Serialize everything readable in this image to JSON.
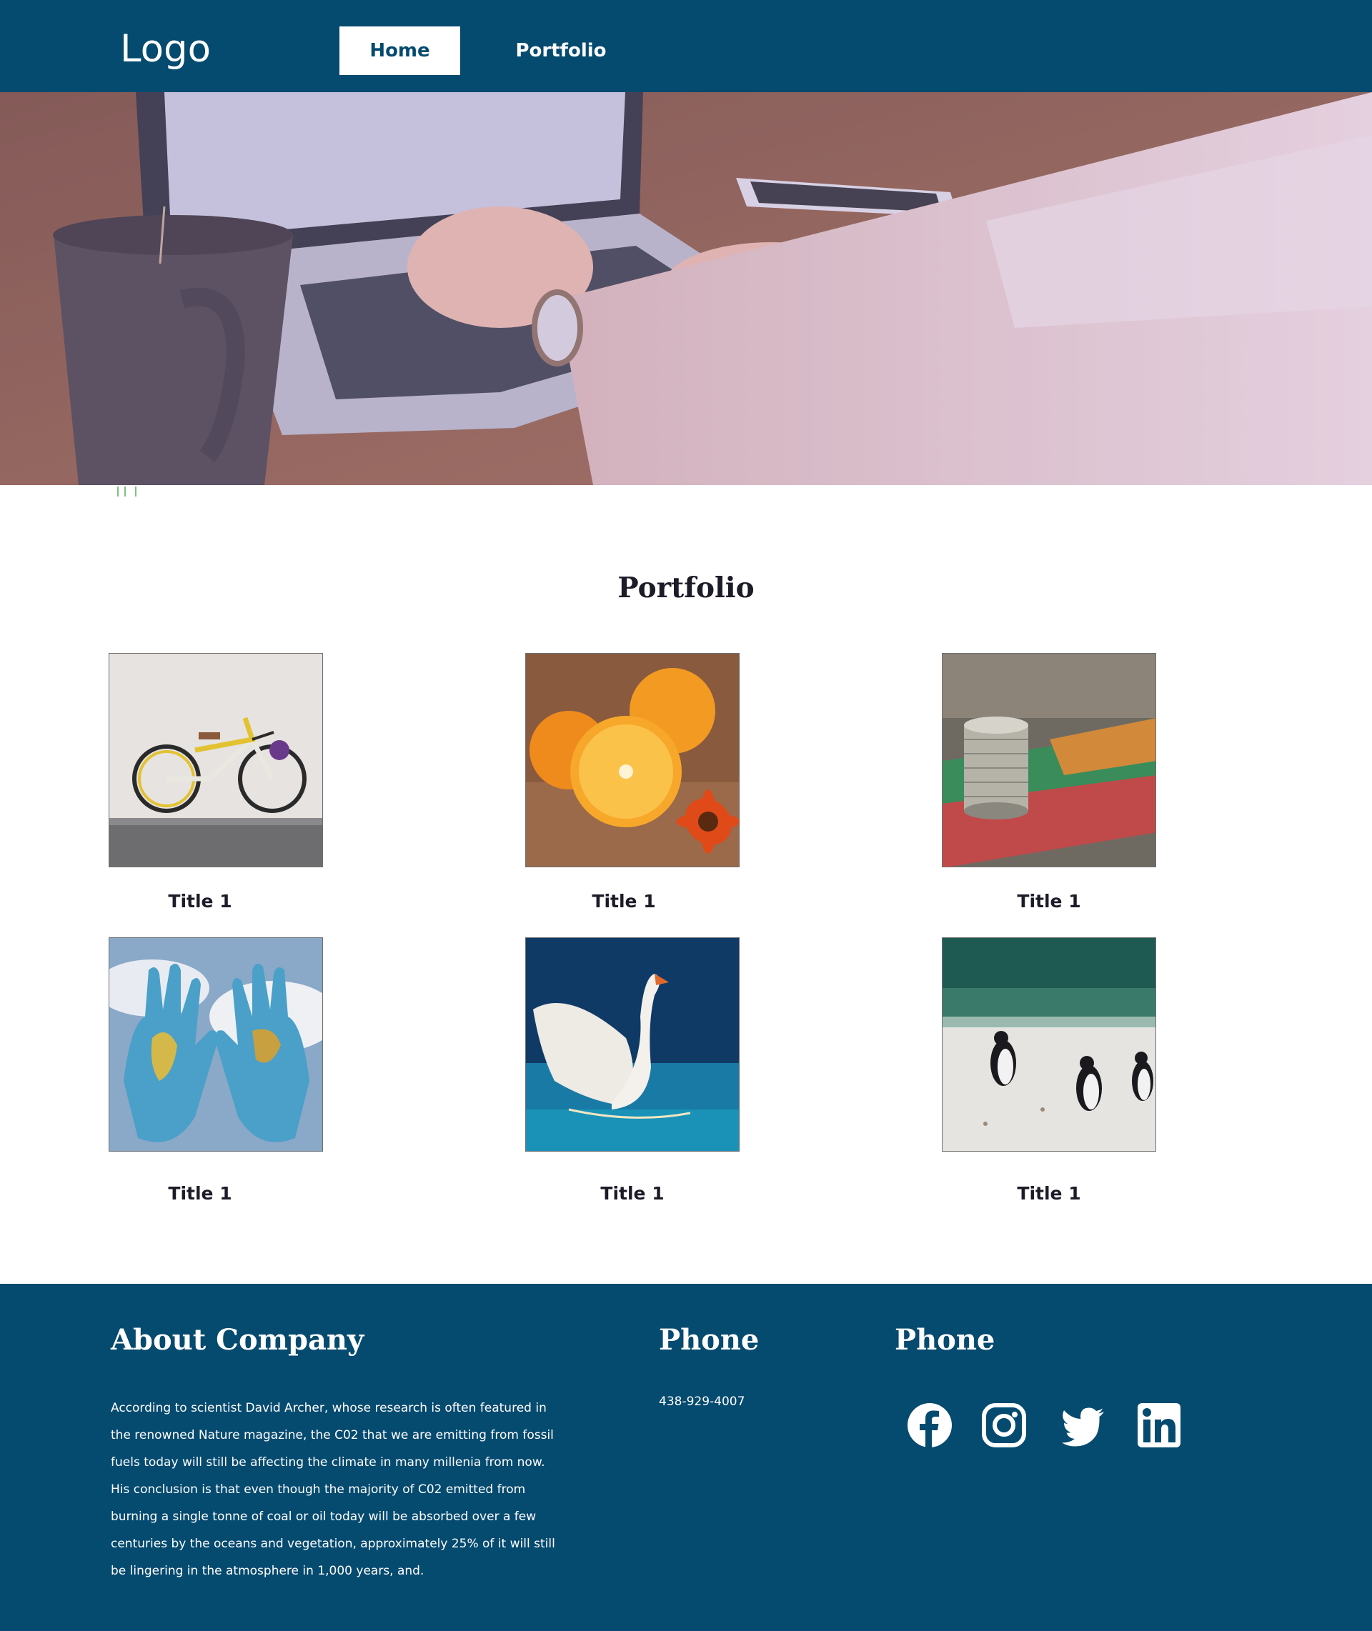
{
  "header": {
    "logo": "Logo",
    "nav": [
      {
        "label": "Home",
        "active": true
      },
      {
        "label": "Portfolio",
        "active": false
      }
    ],
    "background_color": "#054a6f"
  },
  "hero": {
    "image": "laptop-desk-photo"
  },
  "portfolio": {
    "heading": "Portfolio",
    "items": [
      {
        "title": "Title 1",
        "image": "bicycle-photo"
      },
      {
        "title": "Title 1",
        "image": "oranges-photo"
      },
      {
        "title": "Title 1",
        "image": "coins-photo"
      },
      {
        "title": "Title 1",
        "image": "world-hands-photo"
      },
      {
        "title": "Title 1",
        "image": "swan-photo"
      },
      {
        "title": "Title 1",
        "image": "penguins-photo"
      }
    ]
  },
  "footer": {
    "about_heading": "About Company",
    "about_text": "According to scientist David Archer, whose research is often featured in the renowned Nature magazine, the C02 that we are emitting from fossil fuels today will still be affecting the climate in many millenia from now. His conclusion is that even though the majority of C02 emitted from burning a single tonne of coal or oil today will be absorbed over a few centuries by the oceans and vegetation, approximately 25% of it will still be lingering in the atmosphere in 1,000 years, and.",
    "phone_heading": "Phone",
    "phone_number": "438-929-4007",
    "social_heading": "Phone",
    "social_icons": [
      "facebook-icon",
      "instagram-icon",
      "twitter-icon",
      "linkedin-icon"
    ]
  }
}
